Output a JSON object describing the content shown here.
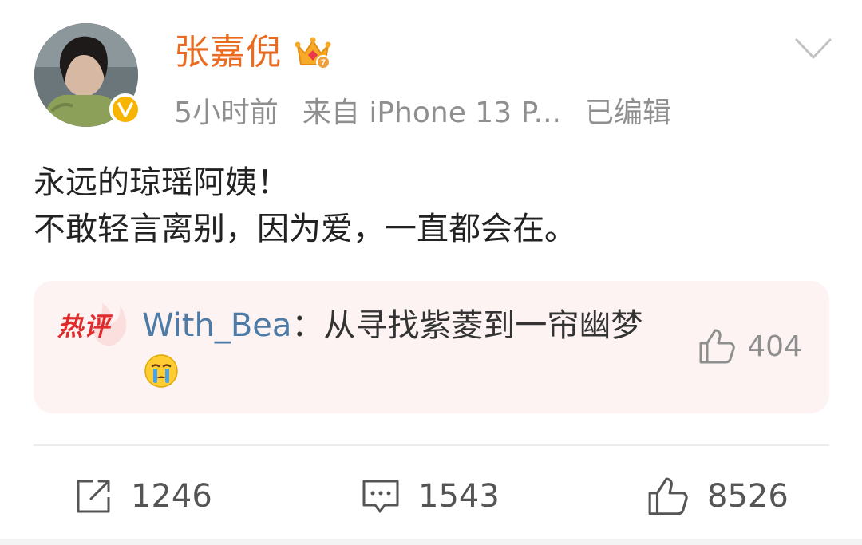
{
  "header": {
    "username": "张嘉倪",
    "time": "5小时前",
    "source": "来自 iPhone 13 P...",
    "edited": "已编辑",
    "colors": {
      "username": "#ea6a1f",
      "verified": "#f7b500"
    }
  },
  "content": {
    "line1": "永远的琼瑶阿姨！",
    "line2": "不敢轻言离别，因为爱，一直都会在。"
  },
  "hot_comment": {
    "badge": "热评",
    "author": "With_Bea",
    "separator": "：",
    "text": "从寻找紫菱到一帘幽梦",
    "emoji": "crying-face-icon",
    "likes": "404"
  },
  "actions": {
    "repost_count": "1246",
    "comment_count": "1543",
    "like_count": "8526"
  }
}
